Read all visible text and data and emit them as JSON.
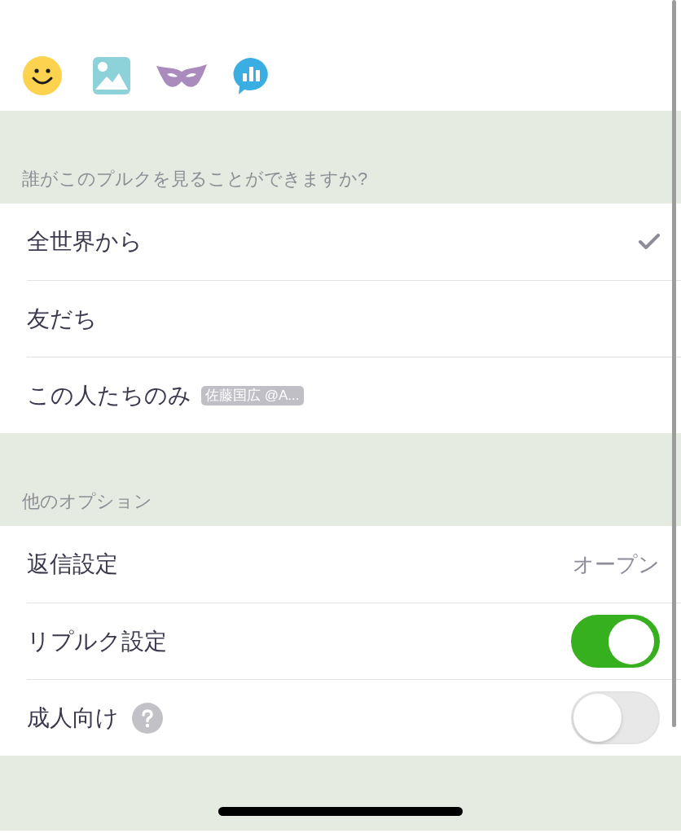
{
  "visibility": {
    "header": "誰がこのプルクを見ることができますか?",
    "options": [
      {
        "label": "全世界から",
        "selected": true
      },
      {
        "label": "友だち",
        "selected": false
      },
      {
        "label": "この人たちのみ",
        "selected": false,
        "badge": "佐藤国広 @A..."
      }
    ]
  },
  "other_options": {
    "header": "他のオプション",
    "rows": [
      {
        "kind": "value",
        "label": "返信設定",
        "value": "オープン"
      },
      {
        "kind": "toggle",
        "label": "リプルク設定",
        "on": true
      },
      {
        "kind": "toggle",
        "label": "成人向け",
        "on": false,
        "help": true
      }
    ]
  }
}
